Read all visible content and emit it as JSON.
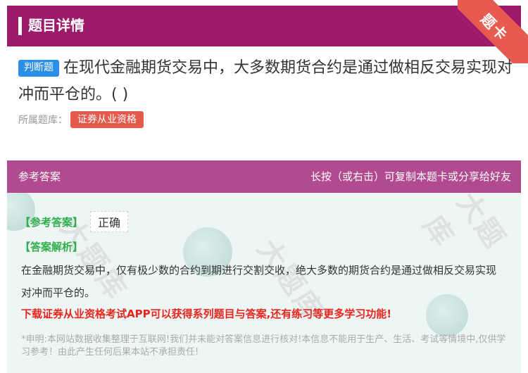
{
  "header": {
    "title": "题目详情",
    "corner_ribbon": "题卡"
  },
  "question": {
    "type_tag": "判断题",
    "text": "在现代金融期货交易中，大多数期货合约是通过做相反交易实现对冲而平仓的。( )",
    "bank_label": "所属题库：",
    "bank_name": "证券从业资格"
  },
  "answer": {
    "bar_left": "参考答案",
    "bar_right": "长按（或右击）可复制本题卡或分享给好友",
    "ref_label": "【参考答案】",
    "ref_value": "正确",
    "analysis_label": "【答案解析】",
    "analysis_text": "在金融期货交易中，仅有极少数的合约到期进行交割交收，绝大多数的期货合约是通过做相反交易实现对冲而平仓的。",
    "promo": "下载证券从业资格考试APP可以获得系列题目与答案,还有练习等更多学习功能!",
    "disclaimer": "*申明:本网站数据收集整理于互联网!我们并未能对答案信息进行核对!本信息不能用于生产、生活、考试等情境中,仅供学习参考！由此产生任何后果本站不承担责任!"
  },
  "colors": {
    "header_bg": "#9b1a6a",
    "answer_bar_bg": "#b14a8e",
    "ribbon": "#e65a4f",
    "type_tag": "#2b8fe8",
    "bank_tag": "#e45a4d",
    "label_green": "#2fae4b",
    "promo_red": "#e8261c"
  }
}
